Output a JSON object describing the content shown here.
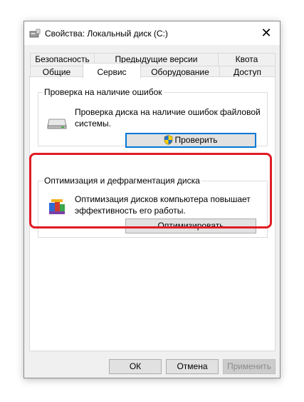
{
  "window": {
    "title": "Свойства: Локальный диск (C:)",
    "close_glyph": "✕"
  },
  "tabs_row1": [
    "Безопасность",
    "Предыдущие версии",
    "Квота"
  ],
  "tabs_row2": [
    "Общие",
    "Сервис",
    "Оборудование",
    "Доступ"
  ],
  "active_tab": "Сервис",
  "check": {
    "title": "Проверка на наличие ошибок",
    "description_line1": "Проверка диска на наличие ошибок файловой",
    "description_line2": "системы.",
    "button_label": "Проверить"
  },
  "optimize": {
    "title": "Оптимизация и дефрагментация диска",
    "description_line1": "Оптимизация дисков компьютера повышает",
    "description_line2": "эффективность его работы.",
    "button_label": "Оптимизировать"
  },
  "footer": {
    "ok": "ОК",
    "cancel": "Отмена",
    "apply": "Применить"
  },
  "colors": {
    "highlight": "#e01c24",
    "focus": "#0078d7"
  },
  "icons": {
    "title": "drive-properties-icon",
    "check": "hard-drive-icon",
    "shield": "uac-shield-icon",
    "optimize": "defrag-icon"
  }
}
